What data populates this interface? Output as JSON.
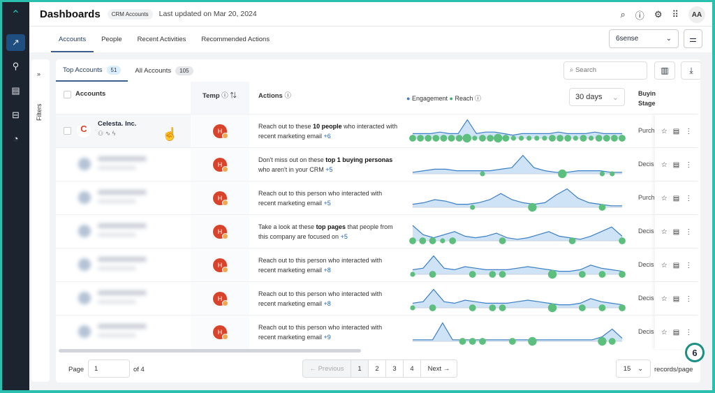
{
  "header": {
    "title": "Dashboards",
    "chip": "CRM Accounts",
    "updated": "Last updated on Mar 20, 2024",
    "avatar": "AA"
  },
  "tabs": [
    "Accounts",
    "People",
    "Recent Activities",
    "Recommended Actions"
  ],
  "source_select": "6sense",
  "filters_label": "Filters",
  "subtabs": [
    {
      "label": "Top Accounts",
      "count": "51"
    },
    {
      "label": "All Accounts",
      "count": "105"
    }
  ],
  "search_placeholder": "Search",
  "columns": {
    "accounts": "Accounts",
    "temp": "Temp",
    "actions": "Actions",
    "engagement": "Engagement",
    "reach": "Reach",
    "range": "30 days",
    "stage1": "Buyin",
    "stage2": "Stage"
  },
  "colors": {
    "engagement": "#3b7fc4",
    "reach": "#3fae6a",
    "accent": "#2bbfb0",
    "temp": "#d8432a"
  },
  "rows": [
    {
      "name": "Celesta. Inc.",
      "temp": "H",
      "pre": "Reach out to these ",
      "bold": "10 people",
      "post": " who interacted with recent marketing email ",
      "more": "+6",
      "stage": "Purch",
      "eng": [
        3,
        3,
        3,
        4,
        3,
        3,
        12,
        3,
        4,
        4,
        3,
        2,
        3,
        3,
        3,
        3,
        4,
        3,
        3,
        3,
        4,
        3,
        3,
        3
      ],
      "reach": [
        3,
        3,
        3,
        3,
        3,
        3,
        3,
        4,
        2,
        3,
        3,
        4,
        3,
        2,
        2,
        2,
        2,
        2,
        3,
        3,
        3,
        2,
        3,
        2,
        3,
        3,
        3,
        3
      ]
    },
    {
      "name": "",
      "temp": "H",
      "pre": "Don't miss out on these ",
      "bold": "top 1 buying personas",
      "post": " who aren't in your CRM ",
      "more": "+5",
      "stage": "Decis",
      "eng": [
        1,
        2,
        3,
        3,
        2,
        2,
        2,
        2,
        3,
        4,
        12,
        4,
        2,
        1,
        1,
        2,
        2,
        2,
        1,
        1
      ],
      "reach": [
        0,
        0,
        0,
        0,
        0,
        0,
        0,
        2,
        0,
        0,
        0,
        0,
        0,
        0,
        0,
        4,
        0,
        0,
        0,
        2,
        2,
        0
      ]
    },
    {
      "name": "",
      "temp": "H",
      "pre": "Reach out to this person who interacted with recent marketing email ",
      "bold": "",
      "post": "",
      "more": "+5",
      "stage": "Purch",
      "eng": [
        2,
        3,
        5,
        4,
        2,
        2,
        3,
        5,
        9,
        5,
        3,
        2,
        3,
        8,
        12,
        6,
        3,
        2,
        1,
        1
      ],
      "reach": [
        0,
        0,
        0,
        0,
        0,
        0,
        2,
        0,
        0,
        0,
        0,
        0,
        4,
        0,
        0,
        0,
        0,
        0,
        0,
        3,
        0,
        0
      ]
    },
    {
      "name": "",
      "temp": "H",
      "pre": "Take a look at these ",
      "bold": "top pages",
      "post": " that people from this company are focused on ",
      "more": "+5",
      "stage": "Decis",
      "eng": [
        10,
        4,
        2,
        4,
        6,
        3,
        2,
        3,
        5,
        2,
        1,
        2,
        4,
        6,
        3,
        2,
        1,
        3,
        6,
        9,
        3
      ],
      "reach": [
        3,
        3,
        3,
        2,
        3,
        0,
        0,
        0,
        0,
        3,
        0,
        0,
        0,
        0,
        0,
        0,
        3,
        0,
        0,
        0,
        0,
        3
      ]
    },
    {
      "name": "",
      "temp": "H",
      "pre": "Reach out to this person who interacted with recent marketing email ",
      "bold": "",
      "post": "",
      "more": "+8",
      "stage": "Decis",
      "eng": [
        3,
        4,
        12,
        4,
        3,
        5,
        4,
        3,
        3,
        3,
        4,
        5,
        4,
        3,
        2,
        2,
        3,
        6,
        4,
        3,
        2
      ],
      "reach": [
        2,
        0,
        3,
        0,
        0,
        0,
        3,
        0,
        3,
        3,
        0,
        0,
        0,
        0,
        4,
        0,
        0,
        3,
        0,
        3,
        0,
        3
      ]
    },
    {
      "name": "",
      "temp": "H",
      "pre": "Reach out to this person who interacted with recent marketing email ",
      "bold": "",
      "post": "",
      "more": "+8",
      "stage": "Decis",
      "eng": [
        3,
        4,
        12,
        4,
        3,
        5,
        4,
        3,
        3,
        3,
        4,
        5,
        4,
        3,
        2,
        2,
        3,
        6,
        4,
        3,
        2
      ],
      "reach": [
        2,
        0,
        3,
        0,
        0,
        0,
        3,
        0,
        3,
        3,
        0,
        0,
        0,
        0,
        4,
        0,
        0,
        3,
        0,
        3,
        0,
        3
      ]
    },
    {
      "name": "",
      "temp": "H",
      "pre": "Reach out to this person who interacted with recent marketing email ",
      "bold": "",
      "post": "",
      "more": "+9",
      "stage": "Decis",
      "eng": [
        1,
        1,
        1,
        12,
        1,
        1,
        1,
        1,
        1,
        1,
        1,
        1,
        1,
        1,
        1,
        1,
        1,
        1,
        1,
        3,
        8,
        2
      ],
      "reach": [
        0,
        0,
        0,
        0,
        0,
        3,
        3,
        3,
        0,
        0,
        3,
        0,
        4,
        0,
        0,
        0,
        0,
        0,
        0,
        4,
        3,
        0
      ]
    }
  ],
  "pager": {
    "page_label": "Page",
    "page": "1",
    "of": "of 4",
    "prev": "← Previous",
    "pages": [
      "1",
      "2",
      "3",
      "4"
    ],
    "next": "Next →",
    "size": "15",
    "size_label": "records/page"
  }
}
